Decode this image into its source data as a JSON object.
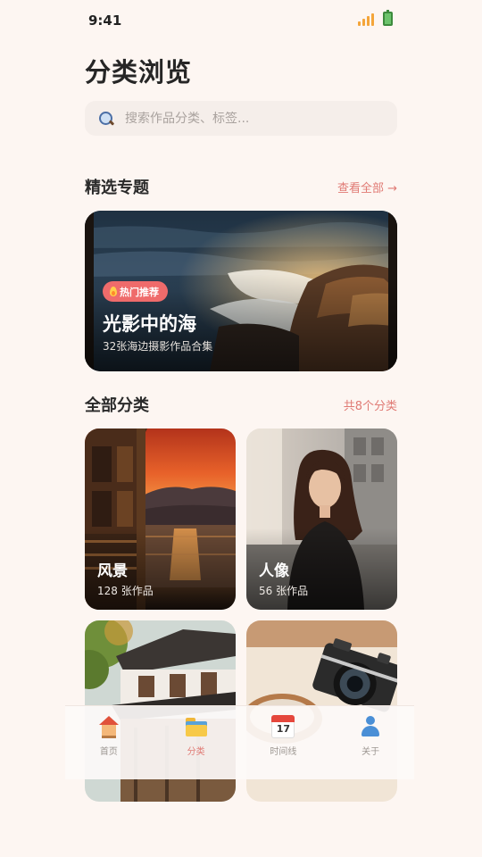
{
  "status_bar": {
    "time": "9:41"
  },
  "page_title": "分类浏览",
  "search": {
    "placeholder": "搜索作品分类、标签..."
  },
  "featured_section": {
    "title": "精选专题",
    "link_label": "查看全部 →",
    "card": {
      "badge": "热门推荐",
      "title": "光影中的海",
      "subtitle": "32张海边摄影作品合集"
    }
  },
  "categories_section": {
    "title": "全部分类",
    "count_label": "共8个分类",
    "items": [
      {
        "name": "风景",
        "count": "128 张作品"
      },
      {
        "name": "人像",
        "count": "56 张作品"
      },
      {
        "name": "",
        "count": ""
      },
      {
        "name": "",
        "count": ""
      }
    ]
  },
  "bottom_nav": {
    "items": [
      {
        "label": "首页",
        "icon": "home-icon",
        "active": false
      },
      {
        "label": "分类",
        "icon": "folder-icon",
        "active": true
      },
      {
        "label": "时间线",
        "icon": "calendar-icon",
        "active": false
      },
      {
        "label": "关于",
        "icon": "person-icon",
        "active": false
      }
    ]
  },
  "colors": {
    "background": "#fdf6f2",
    "accent": "#e07a74",
    "badge": "#ef6b6b"
  }
}
